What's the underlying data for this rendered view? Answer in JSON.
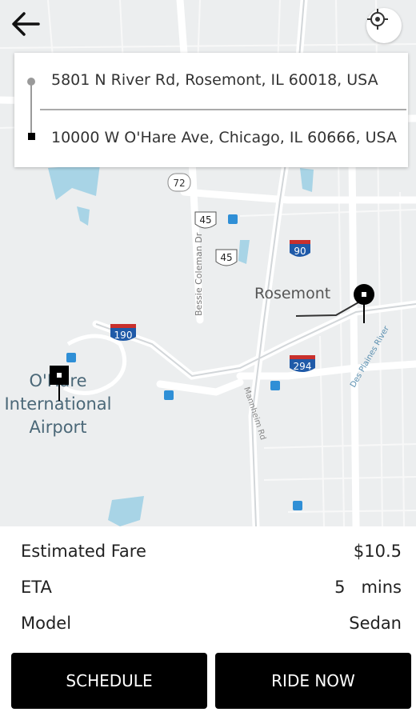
{
  "header": {
    "back_icon": "arrow-left-icon",
    "locate_icon": "crosshair-icon"
  },
  "route": {
    "pickup_address": "5801 N River Rd, Rosemont, IL 60018, USA",
    "dropoff_address": "10000 W O'Hare Ave, Chicago, IL 60666, USA"
  },
  "map": {
    "labels": {
      "rosemont": "Rosemont",
      "airport_line1": "O'Hare",
      "airport_line2": "International",
      "airport_line3": "Airport",
      "bessie_coleman": "Bessie Coleman Dr",
      "des_plaines": "Des Plaines River",
      "mannheim": "Mannheim Rd"
    },
    "shields": {
      "route_72": "72",
      "us_45_a": "45",
      "us_45_b": "45",
      "i_90": "90",
      "i_190": "190",
      "i_294": "294"
    },
    "colors": {
      "background": "#eceeef",
      "road": "#ffffff",
      "water": "#a8d4e6",
      "interstate_red": "#c9302c",
      "interstate_blue": "#1f5aa8"
    }
  },
  "trip": {
    "fare_label": "Estimated Fare",
    "fare_value": "$10.5",
    "eta_label": "ETA",
    "eta_value": "5   mins",
    "model_label": "Model",
    "model_value": "Sedan"
  },
  "actions": {
    "schedule_label": "SCHEDULE",
    "ride_now_label": "RIDE NOW"
  }
}
